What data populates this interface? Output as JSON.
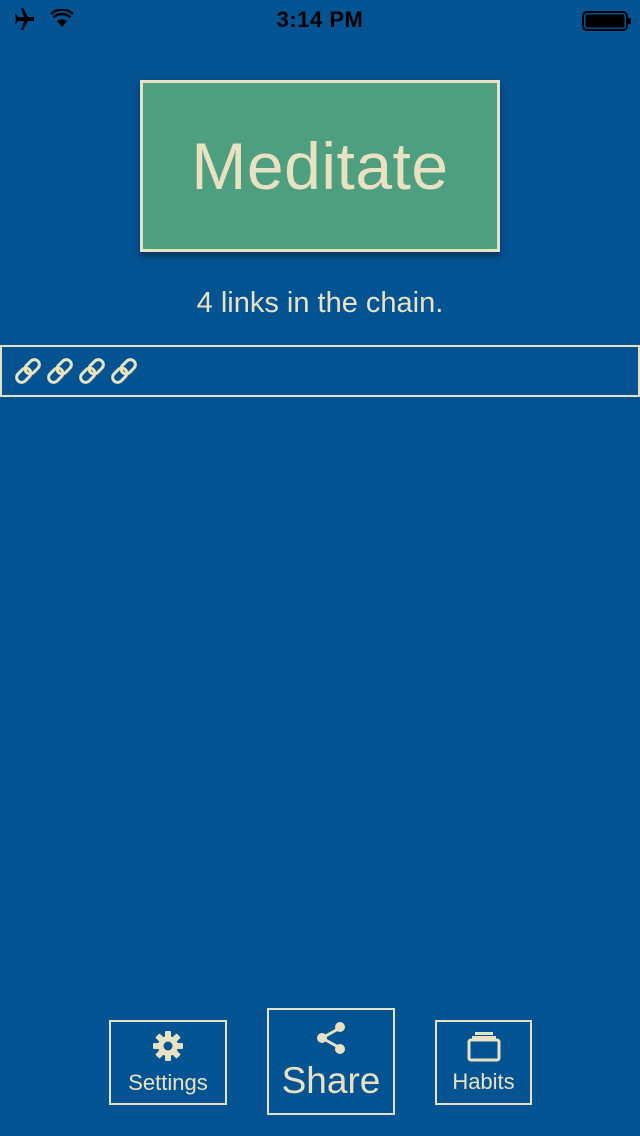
{
  "status_bar": {
    "time": "3:14 PM",
    "icons": [
      "airplane-icon",
      "wifi-icon",
      "battery-icon"
    ]
  },
  "habit": {
    "name": "Meditate",
    "chain_text": "4 links in the chain.",
    "link_count": 4
  },
  "toolbar": {
    "settings_label": "Settings",
    "share_label": "Share",
    "habits_label": "Habits"
  },
  "colors": {
    "background": "#045392",
    "accent": "#E9E2C2",
    "habit_button": "#4E9F7F"
  }
}
